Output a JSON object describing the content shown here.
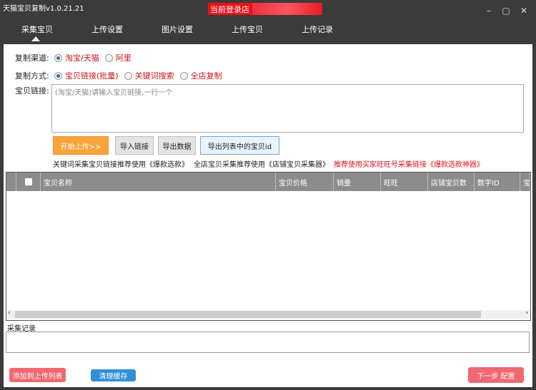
{
  "window": {
    "title": "天猫宝贝复制v1.0.21.21",
    "login_label": "当前登录店"
  },
  "tabs": [
    "采集宝贝",
    "上传设置",
    "图片设置",
    "上传宝贝",
    "上传记录"
  ],
  "form": {
    "channel_label": "复制渠道:",
    "channel_options": [
      "淘宝/天猫",
      "阿里"
    ],
    "method_label": "复制方式:",
    "method_options": [
      "宝贝链接(批量)",
      "关键词搜索",
      "全店复制"
    ],
    "links_label": "宝贝链接:",
    "links_placeholder": "(淘宝/天猫)请输入宝贝链接,一行一个"
  },
  "buttons": {
    "start": "开始上传>>",
    "import": "导入链接",
    "export": "导出数据",
    "export_ids": "导出列表中的宝贝id"
  },
  "tips": {
    "t1": "关键词采集宝贝链接推荐使用《爆款选款》",
    "t2": "全店宝贝采集推荐使用《店铺宝贝采集器》",
    "t3": "推荐使用买家旺旺号采集链接《爆款选款神器》"
  },
  "table": {
    "columns": [
      "宝贝名称",
      "宝贝价格",
      "销量",
      "旺旺",
      "店铺宝贝数",
      "数字ID",
      "宝"
    ]
  },
  "log": {
    "label": "采集记录"
  },
  "footer": {
    "add": "添加到上传列表",
    "clear": "清理缓存",
    "next": "下一步 配置"
  }
}
